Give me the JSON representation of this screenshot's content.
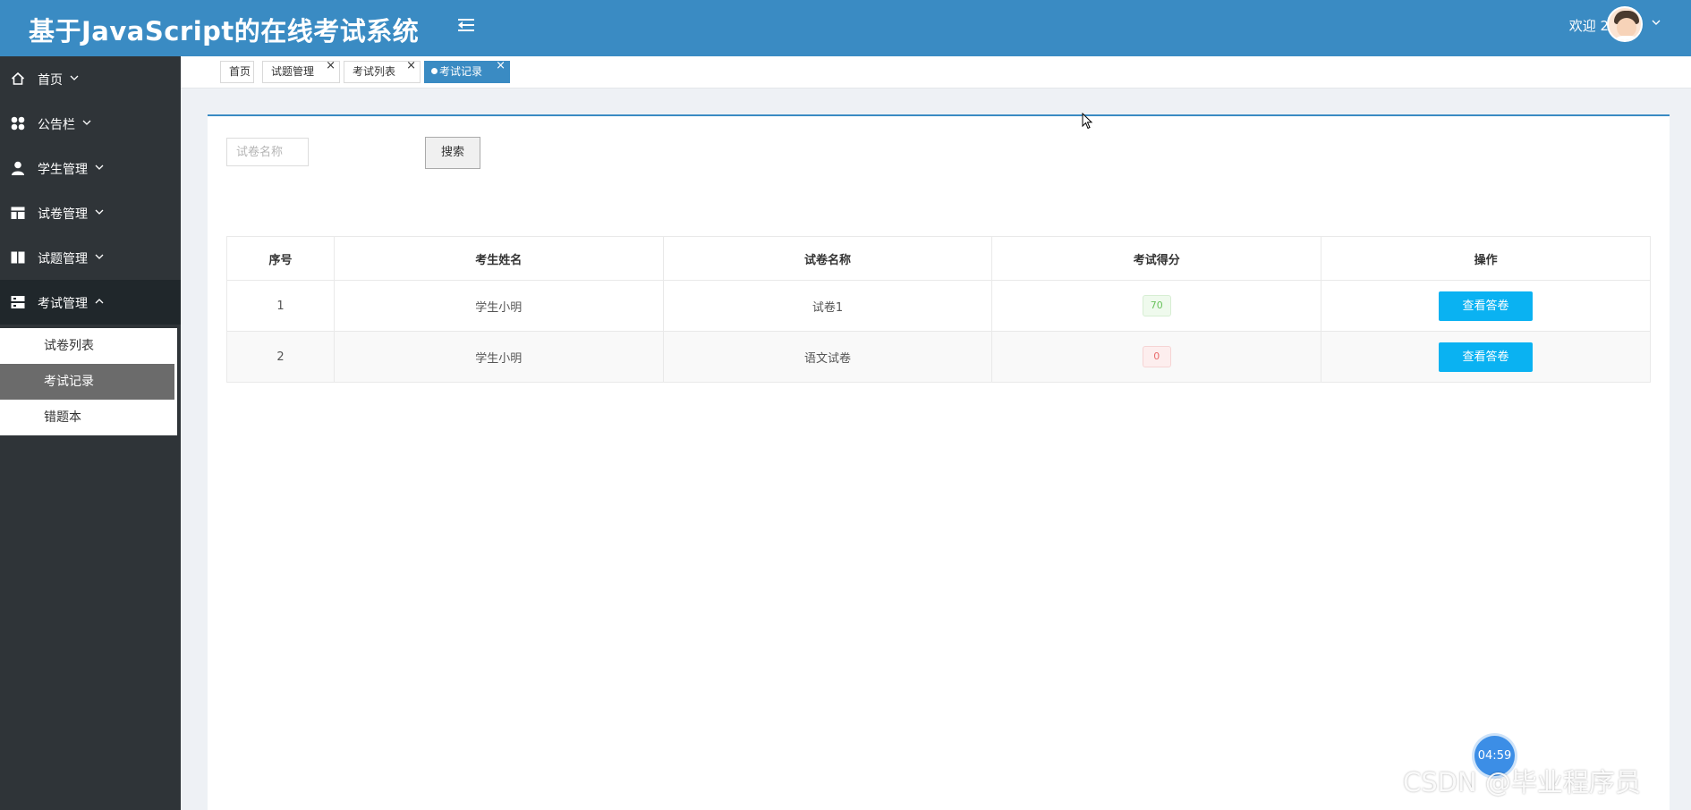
{
  "header": {
    "app_title": "基于JavaScript的在线考试系统",
    "welcome_text": "欢迎 2",
    "menu_toggle_icon": "menu-fold-icon",
    "bg_color": "#3a8bc3"
  },
  "sidebar": {
    "items": [
      {
        "label": "首页",
        "icon": "home-icon"
      },
      {
        "label": "公告栏",
        "icon": "apps-icon"
      },
      {
        "label": "学生管理",
        "icon": "user-icon"
      },
      {
        "label": "试卷管理",
        "icon": "layout-icon"
      },
      {
        "label": "试题管理",
        "icon": "columns-icon"
      },
      {
        "label": "考试管理",
        "icon": "server-icon",
        "expanded": true
      }
    ],
    "submenu": [
      {
        "label": "试卷列表"
      },
      {
        "label": "考试记录",
        "active": true
      },
      {
        "label": "错题本"
      }
    ]
  },
  "tabs": [
    {
      "label": "首页",
      "closable": false
    },
    {
      "label": "试题管理",
      "closable": true
    },
    {
      "label": "考试列表",
      "closable": true
    },
    {
      "label": "考试记录",
      "closable": true,
      "active": true
    }
  ],
  "tab_close_glyph": "×",
  "search": {
    "placeholder": "试卷名称",
    "button_label": "搜索"
  },
  "table": {
    "columns": [
      "序号",
      "考生姓名",
      "试卷名称",
      "考试得分",
      "操作"
    ],
    "rows": [
      {
        "index": "1",
        "student": "学生小明",
        "paper": "试卷1",
        "score": "70",
        "status": "pass",
        "action": "查看答卷"
      },
      {
        "index": "2",
        "student": "学生小明",
        "paper": "语文试卷",
        "score": "0",
        "status": "fail",
        "action": "查看答卷"
      }
    ]
  },
  "timer": "04:59",
  "watermark": "CSDN @毕业程序员"
}
